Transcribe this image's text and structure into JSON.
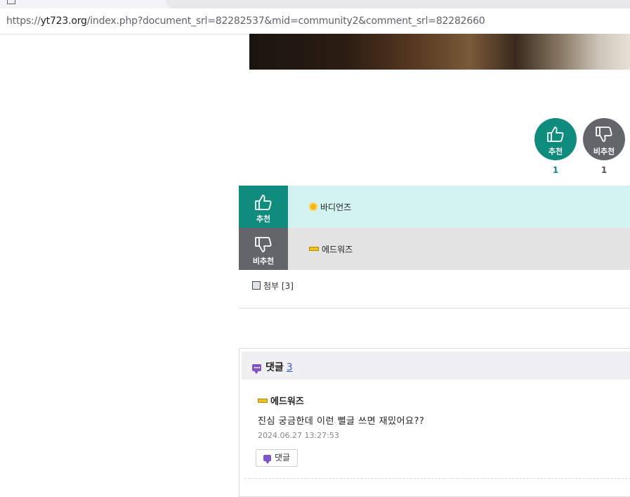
{
  "browser": {
    "url_scheme": "https://",
    "url_domain": "yt723.org",
    "url_path": "/index.php?document_srl=82282537&mid=community2&comment_srl=82282660"
  },
  "votes": {
    "up_label": "추천",
    "down_label": "비추천",
    "up_count": "1",
    "down_count": "1"
  },
  "voters": {
    "up_label": "추천",
    "down_label": "비추천",
    "up_name": "바디언즈",
    "down_name": "에드워즈"
  },
  "attachment": {
    "label": "첨부 [3]"
  },
  "comments": {
    "title": "댓글",
    "count": "3",
    "items": [
      {
        "author": "에드워즈",
        "text": "진심 궁금한데 이런 뻘글 쓰면 재밌어요??",
        "date": "2024.06.27 13:27:53",
        "reply_label": "댓글"
      }
    ]
  },
  "colors": {
    "accent_up": "#0f8c7e",
    "accent_down": "#62656a",
    "up_row_bg": "#d2f3f0",
    "down_row_bg": "#e3e3e4"
  }
}
